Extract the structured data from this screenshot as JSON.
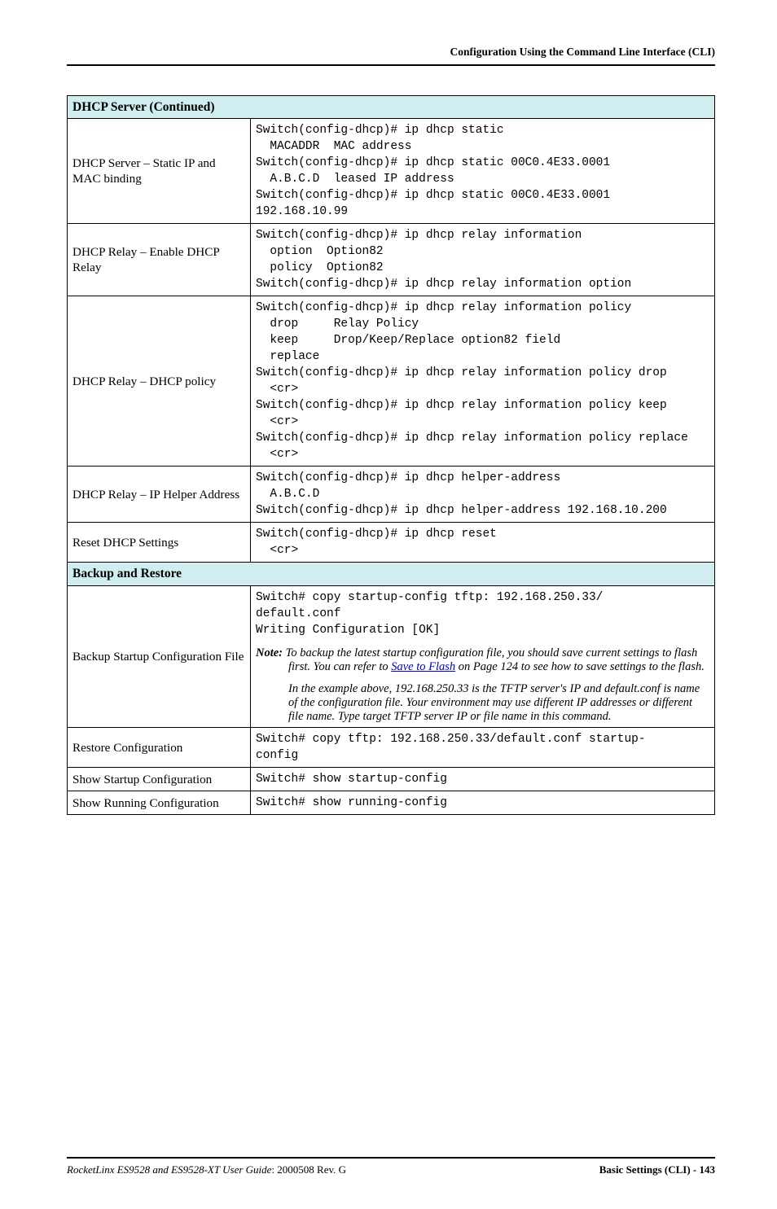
{
  "header": "Configuration Using the Command Line Interface (CLI)",
  "section1": "DHCP Server (Continued)",
  "rows1": [
    {
      "label": "DHCP Server – Static IP and MAC binding",
      "code": "Switch(config-dhcp)# ip dhcp static\n  MACADDR  MAC address\nSwitch(config-dhcp)# ip dhcp static 00C0.4E33.0001\n  A.B.C.D  leased IP address\nSwitch(config-dhcp)# ip dhcp static 00C0.4E33.0001 \n192.168.10.99"
    },
    {
      "label": "DHCP Relay – Enable DHCP Relay",
      "code": "Switch(config-dhcp)# ip dhcp relay information\n  option  Option82\n  policy  Option82\nSwitch(config-dhcp)# ip dhcp relay information option"
    },
    {
      "label": "DHCP Relay – DHCP policy",
      "code": "Switch(config-dhcp)# ip dhcp relay information policy\n  drop     Relay Policy\n  keep     Drop/Keep/Replace option82 field\n  replace\nSwitch(config-dhcp)# ip dhcp relay information policy drop\n  <cr>\nSwitch(config-dhcp)# ip dhcp relay information policy keep\n  <cr>\nSwitch(config-dhcp)# ip dhcp relay information policy replace\n  <cr>"
    },
    {
      "label": "DHCP Relay – IP Helper Address",
      "code": "Switch(config-dhcp)# ip dhcp helper-address\n  A.B.C.D\nSwitch(config-dhcp)# ip dhcp helper-address 192.168.10.200"
    },
    {
      "label": "Reset DHCP Settings",
      "code": "Switch(config-dhcp)# ip dhcp reset\n  <cr>"
    }
  ],
  "section2": "Backup and Restore",
  "rows2": [
    {
      "label": "Backup Startup Configuration File",
      "code": "Switch# copy startup-config tftp: 192.168.250.33/\ndefault.conf\nWriting Configuration [OK]",
      "note1_label": "Note:",
      "note1_a": "To backup the latest startup configuration file, you should save current settings to flash first. You can refer to ",
      "note1_link": "Save to Flash",
      "note1_b": " on Page 124 to see how to save settings to the flash.",
      "note2": "In the example above, 192.168.250.33 is the TFTP server's IP and default.conf is name of the configuration file. Your environment may use different IP addresses or different file name. Type target TFTP server IP or file name in this command."
    },
    {
      "label": "Restore Configuration",
      "code": "Switch# copy tftp: 192.168.250.33/default.conf startup-\nconfig"
    },
    {
      "label": "Show Startup Configuration",
      "code": "Switch# show startup-config"
    },
    {
      "label": "Show Running Configuration",
      "code": "Switch# show running-config"
    }
  ],
  "footer": {
    "left_italic": "RocketLinx ES9528 and ES9528-XT User Guide",
    "left_rev": ": 2000508 Rev. G",
    "right": "Basic Settings (CLI) - 143"
  }
}
